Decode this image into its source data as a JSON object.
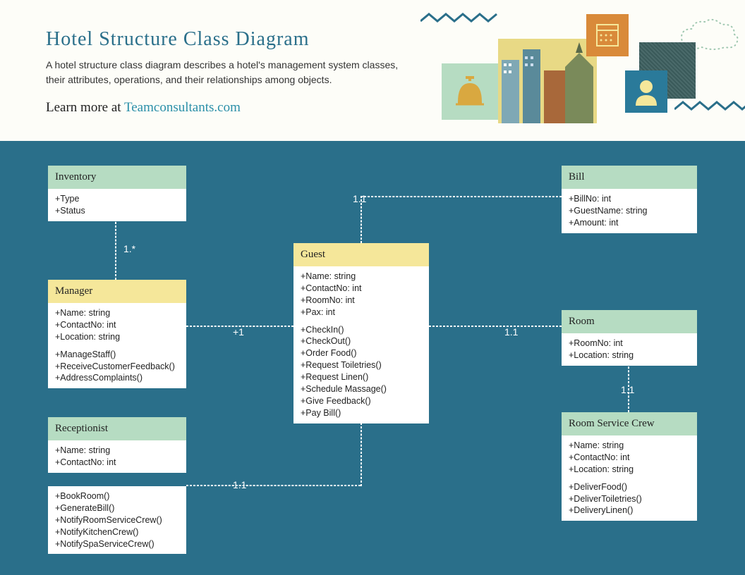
{
  "header": {
    "title": "Hotel Structure Class Diagram",
    "description": "A hotel structure class diagram describes a hotel's management system classes, their attributes, operations, and their relationships among objects.",
    "learn_prefix": "Learn more at ",
    "learn_link": "Teamconsultants.com"
  },
  "classes": {
    "inventory": {
      "name": "Inventory",
      "attrs": [
        "+Type",
        "+Status"
      ]
    },
    "manager": {
      "name": "Manager",
      "attrs": [
        "+Name: string",
        "+ContactNo: int",
        "+Location: string"
      ],
      "ops": [
        "+ManageStaff()",
        "+ReceiveCustomerFeedback()",
        "+AddressComplaints()"
      ]
    },
    "receptionist": {
      "name": "Receptionist",
      "attrs": [
        "+Name: string",
        "+ContactNo: int"
      ],
      "ops": [
        "+BookRoom()",
        "+GenerateBill()",
        "+NotifyRoomServiceCrew()",
        "+NotifyKitchenCrew()",
        "+NotifySpaServiceCrew()"
      ]
    },
    "guest": {
      "name": "Guest",
      "attrs": [
        "+Name: string",
        "+ContactNo: int",
        "+RoomNo: int",
        "+Pax: int"
      ],
      "ops": [
        "+CheckIn()",
        "+CheckOut()",
        "+Order Food()",
        "+Request Toiletries()",
        "+Request Linen()",
        "+Schedule Massage()",
        "+Give Feedback()",
        "+Pay Bill()"
      ]
    },
    "bill": {
      "name": "Bill",
      "attrs": [
        "+BillNo: int",
        "+GuestName: string",
        "+Amount: int"
      ]
    },
    "room": {
      "name": "Room",
      "attrs": [
        "+RoomNo: int",
        "+Location: string"
      ]
    },
    "roomservice": {
      "name": "Room Service Crew",
      "attrs": [
        "+Name: string",
        "+ContactNo: int",
        "+Location: string"
      ],
      "ops": [
        "+DeliverFood()",
        "+DeliverToiletries()",
        "+DeliveryLinen()"
      ]
    }
  },
  "mult": {
    "inv_mgr": "1.*",
    "mgr_guest": "+1",
    "guest_bill": "1.1",
    "guest_room": "1.1",
    "guest_recep": "1.1",
    "room_crew": "1.1"
  }
}
